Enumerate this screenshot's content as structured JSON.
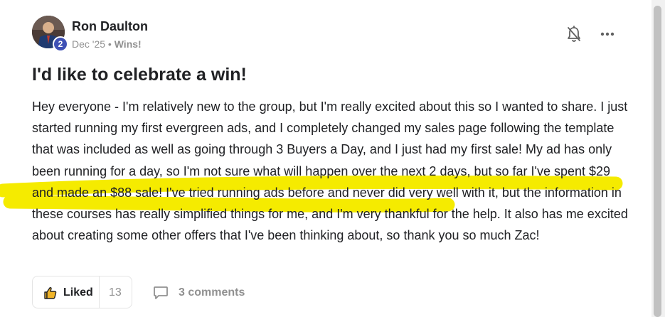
{
  "post": {
    "author": {
      "name": "Ron Daulton",
      "level": "2"
    },
    "meta": {
      "date": "Dec '25",
      "separator": " • ",
      "category": "Wins!"
    },
    "title": "I'd like to celebrate a win!",
    "body": "Hey everyone - I'm relatively new to the group, but I'm really excited about this so I wanted to share. I just started running my first evergreen ads, and I completely changed my sales page following the template that was included as well as going through 3 Buyers a Day, and I just had my first sale! My ad has only been running for a day, so I'm not sure what will happen over the next 2 days, but so far I've spent $29 and made an $88 sale! I've tried running ads before and never did very well with it, but the information in these courses has really simplified things for me, and I'm very thankful for the help. It also has me excited about creating some other offers that I've been thinking about, so thank you so much Zac!",
    "highlight_color": "#f5eb00",
    "actions": {
      "like_label": "Liked",
      "like_count": "13",
      "comments_label": "3 comments"
    }
  },
  "icons": {
    "bell": "bell-off-icon",
    "more": "more-dots-icon",
    "like": "thumbs-up-icon",
    "comment": "comment-icon"
  },
  "colors": {
    "text": "#202124",
    "muted": "#909090",
    "badge": "#3f51b5",
    "border": "#e4e4e4"
  }
}
